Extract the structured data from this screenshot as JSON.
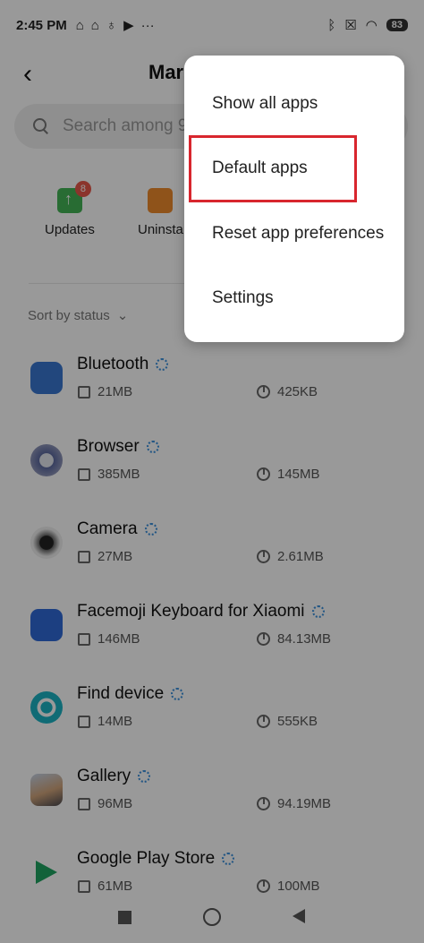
{
  "status_bar": {
    "time": "2:45 PM",
    "battery": "83"
  },
  "header": {
    "title": "Mar",
    "back_icon": "back-arrow-icon"
  },
  "search": {
    "placeholder": "Search among 9"
  },
  "actions": [
    {
      "label": "Updates",
      "badge": "8",
      "color": "#44b556"
    },
    {
      "label": "Uninsta",
      "color": "#ef8a2c"
    }
  ],
  "sort": {
    "label": "Sort by status"
  },
  "apps": [
    {
      "name": "Bluetooth",
      "size": "21MB",
      "data": "425KB"
    },
    {
      "name": "Browser",
      "size": "385MB",
      "data": "145MB"
    },
    {
      "name": "Camera",
      "size": "27MB",
      "data": "2.61MB"
    },
    {
      "name": "Facemoji Keyboard for Xiaomi",
      "size": "146MB",
      "data": "84.13MB"
    },
    {
      "name": "Find device",
      "size": "14MB",
      "data": "555KB"
    },
    {
      "name": "Gallery",
      "size": "96MB",
      "data": "94.19MB"
    },
    {
      "name": "Google Play Store",
      "size": "61MB",
      "data": "100MB"
    }
  ],
  "menu": {
    "items": [
      "Show all apps",
      "Default apps",
      "Reset app preferences",
      "Settings"
    ],
    "highlighted": "Default apps",
    "highlight_color": "#d8262e"
  }
}
